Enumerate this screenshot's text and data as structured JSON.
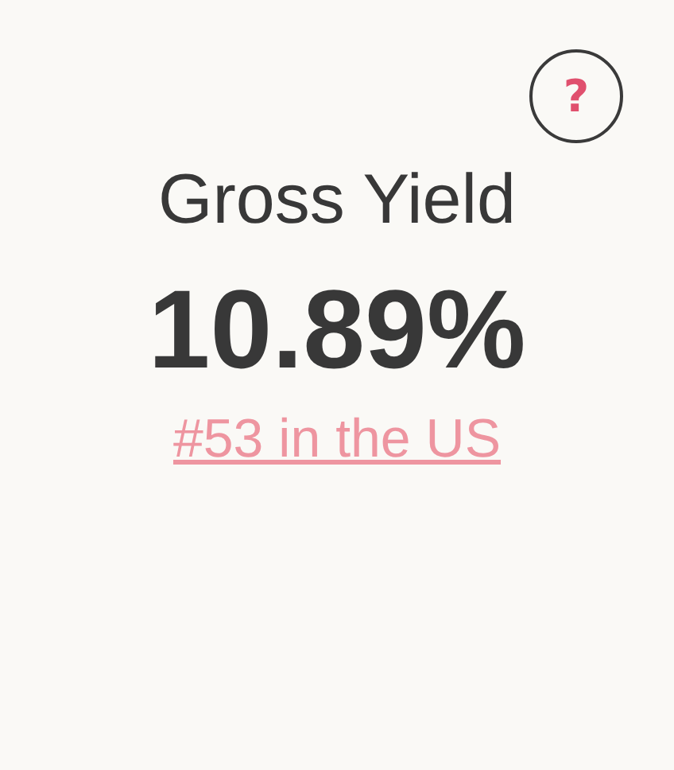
{
  "help_button": {
    "label": "?"
  },
  "metric": {
    "title": "Gross Yield",
    "value": "10.89%",
    "rank_link": "#53 in the US"
  }
}
